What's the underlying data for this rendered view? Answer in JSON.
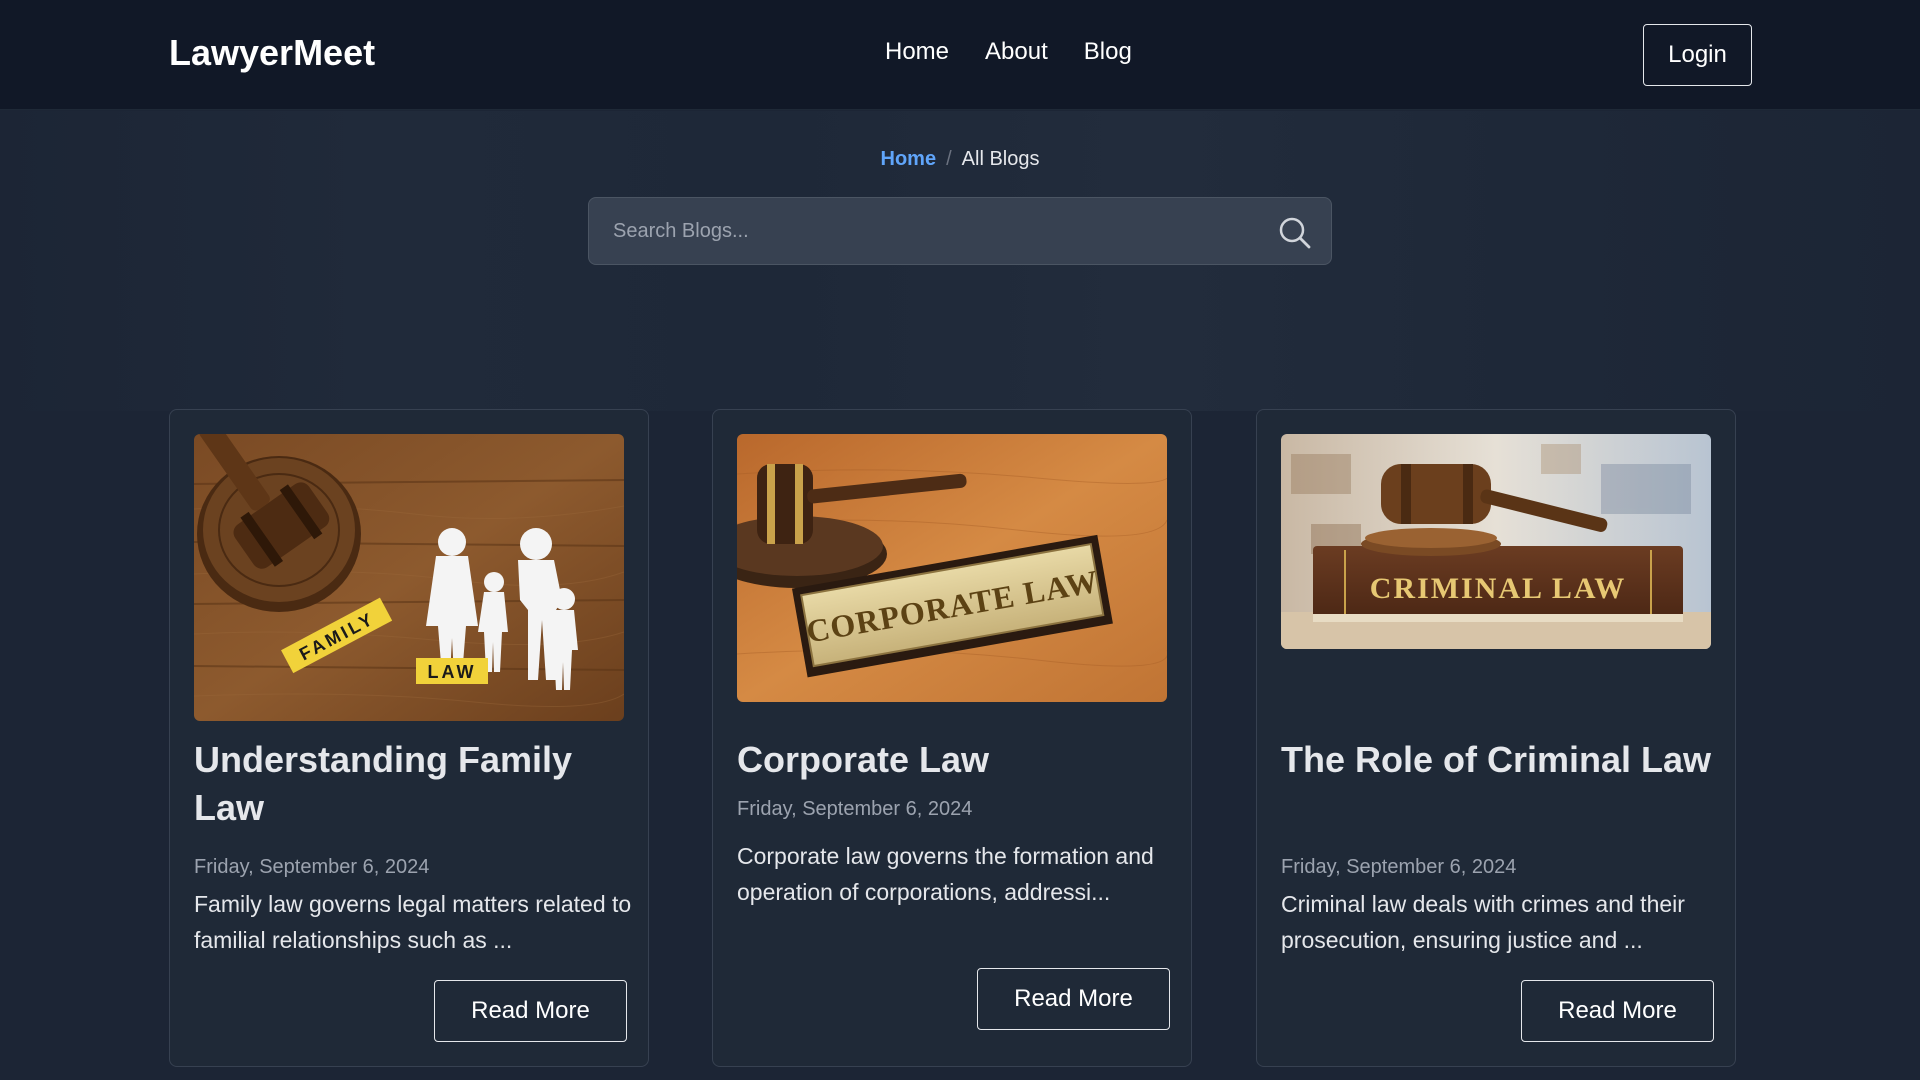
{
  "navbar": {
    "brand": "LawyerMeet",
    "links": [
      "Home",
      "About",
      "Blog"
    ],
    "login_label": "Login"
  },
  "breadcrumb": {
    "home": "Home",
    "separator": "/",
    "current": "All Blogs"
  },
  "search": {
    "placeholder": "Search Blogs...",
    "value": ""
  },
  "icons": {
    "search": "search-icon"
  },
  "colors": {
    "accent": "#60a5fa",
    "background": "#1c2535",
    "card": "#1f2937",
    "navbar": "#111827"
  },
  "posts": [
    {
      "image_text_1": "FAMILY",
      "image_text_2": "LAW",
      "title": "Understanding Family Law",
      "date": "Friday, September 6, 2024",
      "excerpt": "Family law governs legal matters related to familial relationships such as ...",
      "button": "Read More"
    },
    {
      "image_text": "CORPORATE LAW",
      "title": "Corporate Law",
      "date": "Friday, September 6, 2024",
      "excerpt": "Corporate law governs the formation and operation of corporations, addressi...",
      "button": "Read More"
    },
    {
      "image_text": "CRIMINAL LAW",
      "title": "The Role of Criminal Law",
      "date": "Friday, September 6, 2024",
      "excerpt": "Criminal law deals with crimes and their prosecution, ensuring justice and ...",
      "button": "Read More"
    }
  ]
}
